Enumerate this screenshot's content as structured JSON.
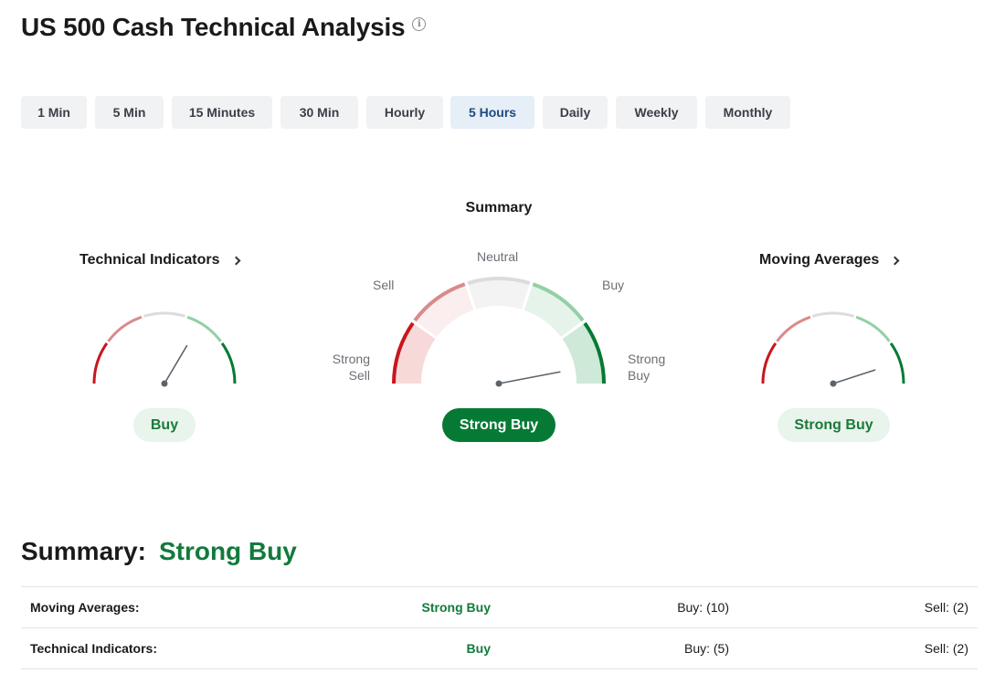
{
  "page": {
    "title": "US 500 Cash Technical Analysis",
    "info_icon": "info-icon"
  },
  "timeframes": [
    {
      "label": "1 Min",
      "active": false
    },
    {
      "label": "5 Min",
      "active": false
    },
    {
      "label": "15 Minutes",
      "active": false
    },
    {
      "label": "30 Min",
      "active": false
    },
    {
      "label": "Hourly",
      "active": false
    },
    {
      "label": "5 Hours",
      "active": true
    },
    {
      "label": "Daily",
      "active": false
    },
    {
      "label": "Weekly",
      "active": false
    },
    {
      "label": "Monthly",
      "active": false
    }
  ],
  "gauges": {
    "heading": "Summary",
    "scale_labels": {
      "strong_sell": "Strong\nSell",
      "sell": "Sell",
      "neutral": "Neutral",
      "buy": "Buy",
      "strong_buy": "Strong\nBuy"
    },
    "technical_indicators": {
      "title": "Technical Indicators",
      "reading": "Buy",
      "needle_level": 0.67
    },
    "summary": {
      "reading": "Strong Buy",
      "needle_level": 0.94
    },
    "moving_averages": {
      "title": "Moving Averages",
      "reading": "Strong Buy",
      "needle_level": 0.9
    },
    "colors": {
      "strong_sell": "#c8161d",
      "sell": "#d98b8b",
      "neutral": "#dcdcdc",
      "buy": "#93d0a6",
      "strong_buy": "#067a34",
      "needle": "#5d636b"
    }
  },
  "summary": {
    "label": "Summary:",
    "value": "Strong Buy",
    "rows": [
      {
        "label": "Moving Averages:",
        "summary": "Strong Buy",
        "buy": "Buy: (10)",
        "sell": "Sell: (2)"
      },
      {
        "label": "Technical Indicators:",
        "summary": "Buy",
        "buy": "Buy: (5)",
        "sell": "Sell: (2)"
      }
    ]
  }
}
